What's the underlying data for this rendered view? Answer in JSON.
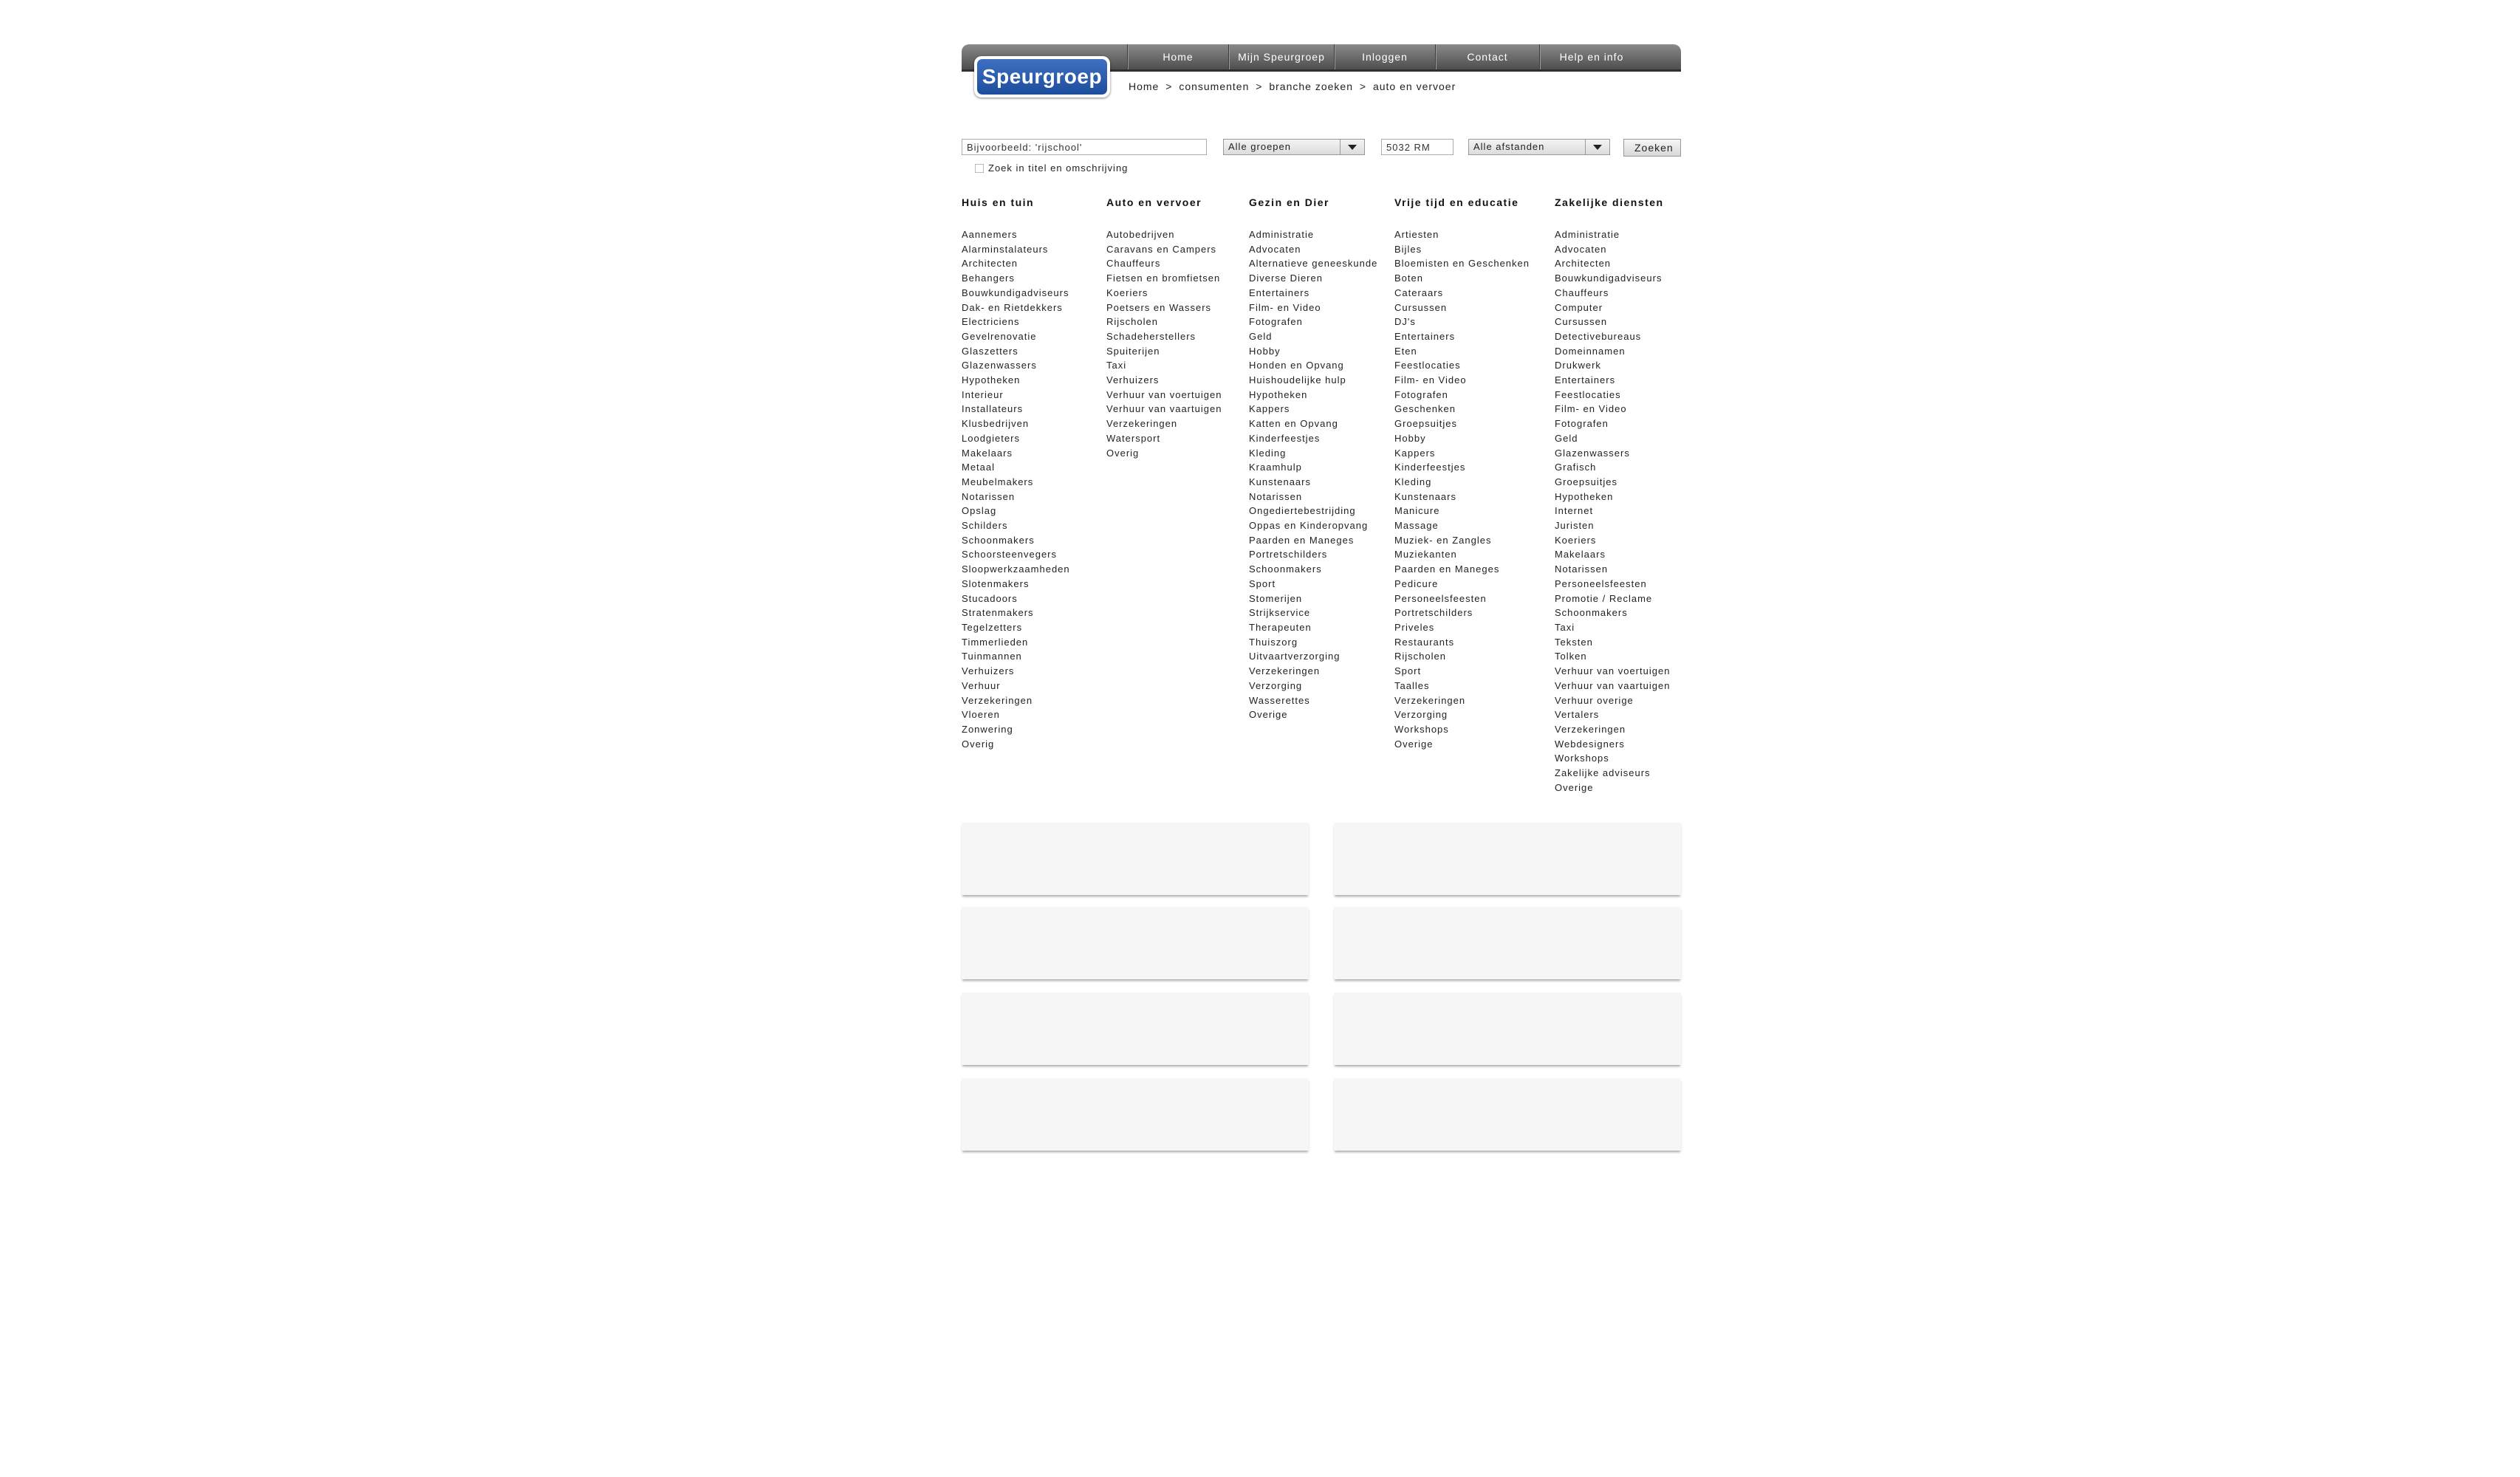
{
  "logo": "Speurgroep",
  "nav": [
    "Home",
    "Mijn Speurgroep",
    "Inloggen",
    "Contact",
    "Help en info"
  ],
  "breadcrumb": [
    "Home",
    "consumenten",
    "branche zoeken",
    "auto en vervoer"
  ],
  "breadcrumb_sep": ">",
  "search": {
    "query_value": "Bijvoorbeeld: 'rijschool'",
    "group_select": "Alle groepen",
    "postcode_value": "5032 RM",
    "distance_select": "Alle afstanden",
    "submit_label": "Zoeken",
    "checkbox_label": "Zoek in titel en omschrijving"
  },
  "columns": [
    {
      "title": "Huis en tuin",
      "items": [
        "Aannemers",
        "Alarminstalateurs",
        "Architecten",
        "Behangers",
        "Bouwkundigadviseurs",
        "Dak- en Rietdekkers",
        "Electriciens",
        "Gevelrenovatie",
        "Glaszetters",
        "Glazenwassers",
        "Hypotheken",
        "Interieur",
        "Installateurs",
        "Klusbedrijven",
        "Loodgieters",
        "Makelaars",
        "Metaal",
        "Meubelmakers",
        "Notarissen",
        "Opslag",
        "Schilders",
        "Schoonmakers",
        "Schoorsteenvegers",
        "Sloopwerkzaamheden",
        "Slotenmakers",
        "Stucadoors",
        "Stratenmakers",
        "Tegelzetters",
        "Timmerlieden",
        "Tuinmannen",
        "Verhuizers",
        "Verhuur",
        "Verzekeringen",
        "Vloeren",
        "Zonwering",
        "Overig"
      ]
    },
    {
      "title": "Auto en vervoer",
      "items": [
        "Autobedrijven",
        "Caravans en Campers",
        "Chauffeurs",
        "Fietsen en bromfietsen",
        "Koeriers",
        "Poetsers en Wassers",
        "Rijscholen",
        "Schadeherstellers",
        "Spuiterijen",
        "Taxi",
        "Verhuizers",
        "Verhuur van voertuigen",
        "Verhuur van vaartuigen",
        "Verzekeringen",
        "Watersport",
        "Overig"
      ]
    },
    {
      "title": "Gezin en Dier",
      "items": [
        "Administratie",
        "Advocaten",
        "Alternatieve geneeskunde",
        "Diverse Dieren",
        "Entertainers",
        "Film- en Video",
        "Fotografen",
        "Geld",
        "Hobby",
        "Honden en Opvang",
        "Huishoudelijke hulp",
        "Hypotheken",
        "Kappers",
        "Katten en Opvang",
        "Kinderfeestjes",
        "Kleding",
        "Kraamhulp",
        "Kunstenaars",
        "Notarissen",
        "Ongediertebestrijding",
        "Oppas en Kinderopvang",
        "Paarden en Maneges",
        "Portretschilders",
        "Schoonmakers",
        "Sport",
        "Stomerijen",
        "Strijkservice",
        "Therapeuten",
        "Thuiszorg",
        "Uitvaartverzorging",
        "Verzekeringen",
        "Verzorging",
        "Wasserettes",
        "Overige"
      ]
    },
    {
      "title": "Vrije tijd en educatie",
      "items": [
        "Artiesten",
        "Bijles",
        "Bloemisten en Geschenken",
        "Boten",
        "Cateraars",
        "Cursussen",
        "DJ's",
        "Entertainers",
        "Eten",
        "Feestlocaties",
        "Film- en Video",
        "Fotografen",
        "Geschenken",
        "Groepsuitjes",
        "Hobby",
        "Kappers",
        "Kinderfeestjes",
        "Kleding",
        "Kunstenaars",
        "Manicure",
        "Massage",
        "Muziek- en Zangles",
        "Muziekanten",
        "Paarden en Maneges",
        "Pedicure",
        "Personeelsfeesten",
        "Portretschilders",
        "Priveles",
        "Restaurants",
        "Rijscholen",
        "Sport",
        "Taalles",
        "Verzekeringen",
        "Verzorging",
        "Workshops",
        "Overige"
      ]
    },
    {
      "title": "Zakelijke diensten",
      "items": [
        "Administratie",
        "Advocaten",
        "Architecten",
        "Bouwkundigadviseurs",
        "Chauffeurs",
        "Computer",
        "Cursussen",
        "Detectivebureaus",
        "Domeinnamen",
        "Drukwerk",
        "Entertainers",
        "Feestlocaties",
        "Film- en Video",
        "Fotografen",
        "Geld",
        "Glazenwassers",
        "Grafisch",
        "Groepsuitjes",
        "Hypotheken",
        "Internet",
        "Juristen",
        "Koeriers",
        "Makelaars",
        "Notarissen",
        "Personeelsfeesten",
        "Promotie / Reclame",
        "Schoonmakers",
        "Taxi",
        "Teksten",
        "Tolken",
        "Verhuur van voertuigen",
        "Verhuur van vaartuigen",
        "Verhuur overige",
        "Vertalers",
        "Verzekeringen",
        "Webdesigners",
        "Workshops",
        "Zakelijke adviseurs",
        "Overige"
      ]
    }
  ]
}
